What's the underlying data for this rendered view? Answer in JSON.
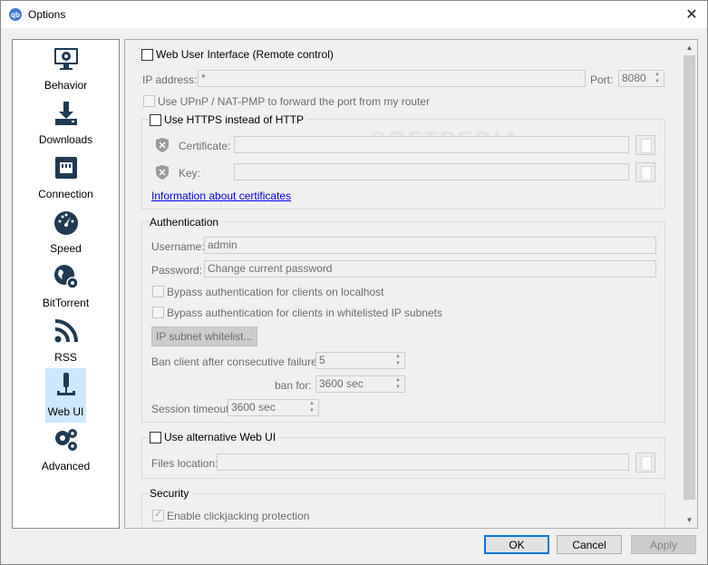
{
  "window": {
    "title": "Options",
    "logo_text": "qb"
  },
  "sidebar": {
    "items": [
      {
        "label": "Behavior",
        "icon": "monitor-gear-icon"
      },
      {
        "label": "Downloads",
        "icon": "download-tray-icon"
      },
      {
        "label": "Connection",
        "icon": "network-port-icon"
      },
      {
        "label": "Speed",
        "icon": "speedometer-icon"
      },
      {
        "label": "BitTorrent",
        "icon": "globe-gear-icon"
      },
      {
        "label": "RSS",
        "icon": "rss-icon"
      },
      {
        "label": "Web UI",
        "icon": "webui-plug-icon",
        "selected": true
      },
      {
        "label": "Advanced",
        "icon": "gears-icon"
      }
    ]
  },
  "webui": {
    "enable_label": "Web User Interface (Remote control)",
    "ip_label": "IP address:",
    "ip_value": "*",
    "port_label": "Port:",
    "port_value": "8080",
    "upnp_label": "Use UPnP / NAT-PMP to forward the port from my router",
    "https_label": "Use HTTPS instead of HTTP",
    "cert_label": "Certificate:",
    "key_label": "Key:",
    "cert_link": "Information about certificates",
    "watermark": "SOFTPEDIA"
  },
  "auth": {
    "title": "Authentication",
    "username_label": "Username:",
    "username_value": "admin",
    "password_label": "Password:",
    "password_placeholder": "Change current password",
    "bypass_localhost": "Bypass authentication for clients on localhost",
    "bypass_whitelist": "Bypass authentication for clients in whitelisted IP subnets",
    "whitelist_button": "IP subnet whitelist...",
    "ban_failures_label": "Ban client after consecutive failures:",
    "ban_failures_value": "5",
    "ban_for_label": "ban for:",
    "ban_for_value": "3600 sec",
    "session_timeout_label": "Session timeout:",
    "session_timeout_value": "3600 sec"
  },
  "alt_webui": {
    "label": "Use alternative Web UI",
    "files_label": "Files location:"
  },
  "security": {
    "title": "Security",
    "clickjacking_label": "Enable clickjacking protection"
  },
  "footer": {
    "ok": "OK",
    "cancel": "Cancel",
    "apply": "Apply"
  },
  "colors": {
    "selection": "#cce8ff",
    "accent": "#0078d7",
    "icon_dark": "#1f3a52"
  }
}
